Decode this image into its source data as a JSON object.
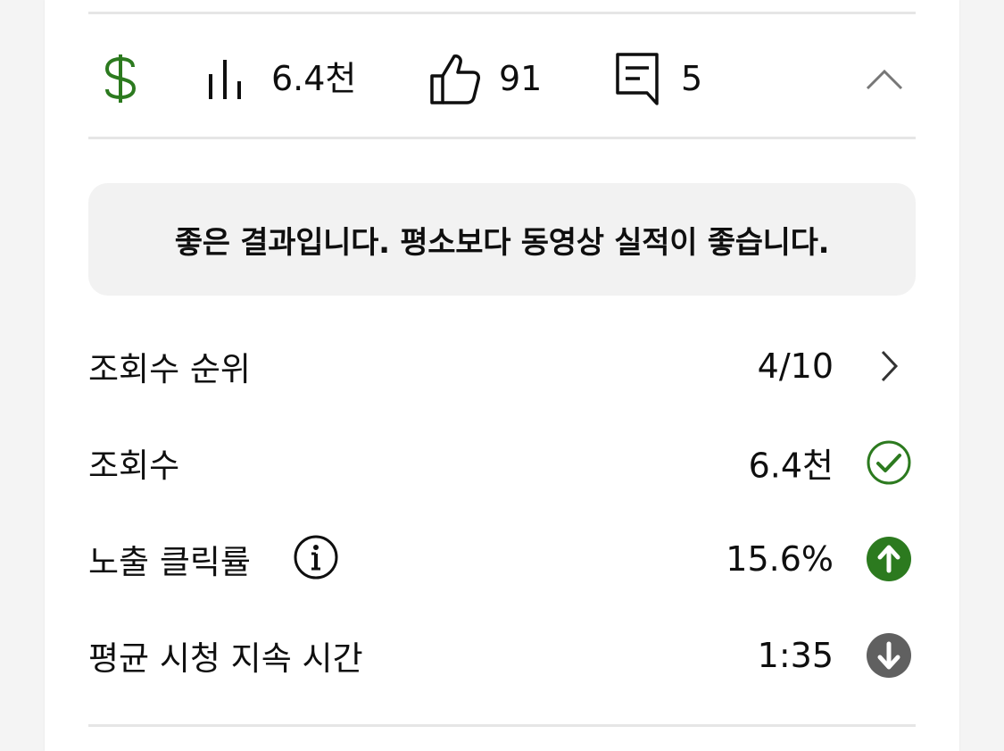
{
  "stats": {
    "monetization_icon": "dollar-icon",
    "views_icon": "bar-chart-icon",
    "views": "6.4천",
    "likes_icon": "thumbs-up-icon",
    "likes": "91",
    "comments_icon": "comment-icon",
    "comments": "5",
    "collapse_icon": "chevron-up-icon"
  },
  "banner": {
    "text": "좋은 결과입니다. 평소보다 동영상 실적이 좋습니다."
  },
  "metrics": [
    {
      "label": "조회수 순위",
      "value": "4/10",
      "trail_icon": "chevron-right-icon"
    },
    {
      "label": "조회수",
      "value": "6.4천",
      "trail_icon": "check-circle-icon"
    },
    {
      "label": "노출 클릭률",
      "value": "15.6%",
      "trail_icon": "arrow-up-circle-icon",
      "info_icon": "info-icon"
    },
    {
      "label": "평균 시청 지속 시간",
      "value": "1:35",
      "trail_icon": "arrow-down-circle-icon"
    }
  ],
  "colors": {
    "accent_green": "#2c7a1f",
    "neutral_dark": "#606060",
    "divider": "#e6e6e6",
    "banner_bg": "#f2f2f2"
  }
}
